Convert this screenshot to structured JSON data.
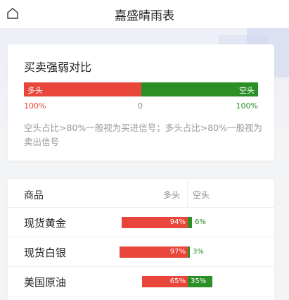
{
  "header": {
    "title": "嘉盛晴雨表",
    "home_icon": "home-icon"
  },
  "colors": {
    "long": "#e8463a",
    "short": "#2a8f25",
    "muted": "#999999"
  },
  "summary": {
    "heading": "买卖强弱对比",
    "long_label": "多头",
    "short_label": "空头",
    "long_ratio": 0.5,
    "long_pct_text": "100%",
    "center_text": "0",
    "short_pct_text": "100%",
    "note": "空头占比>80%一般视为买进信号；多头占比>80%一般视为卖出信号"
  },
  "table": {
    "col_name": "商品",
    "col_long": "多头",
    "col_short": "空头",
    "rows": [
      {
        "name": "现货黄金",
        "long_pct": 94,
        "short_pct": 6,
        "long_text": "94%",
        "short_text": "6%"
      },
      {
        "name": "现货白银",
        "long_pct": 97,
        "short_pct": 3,
        "long_text": "97%",
        "short_text": "3%"
      },
      {
        "name": "美国原油",
        "long_pct": 65,
        "short_pct": 35,
        "long_text": "65%",
        "short_text": "35%"
      }
    ]
  }
}
